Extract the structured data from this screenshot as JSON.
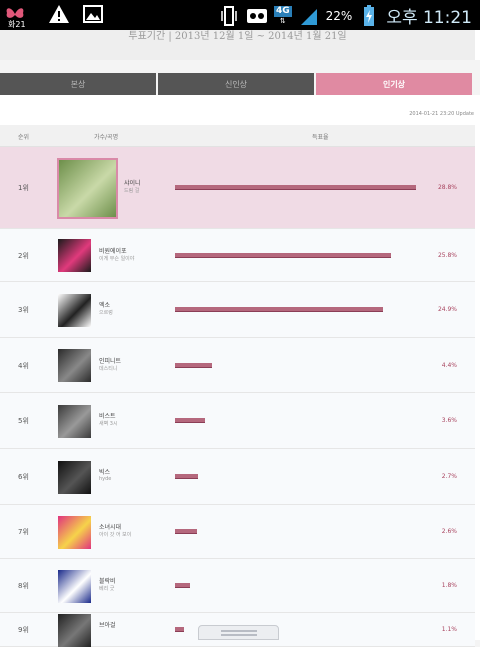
{
  "status_bar": {
    "left_label": "화21",
    "network": "4G",
    "battery": "22%",
    "clock": "오후 11:21"
  },
  "header": {
    "period": "투표기간 | 2013년 12월 1일 ~ 2014년 1월 21일"
  },
  "tabs": [
    {
      "label": "본상",
      "active": false
    },
    {
      "label": "신인상",
      "active": false
    },
    {
      "label": "인기상",
      "active": true
    }
  ],
  "updated": "2014-01-21 23:20 Update",
  "columns": {
    "rank": "순위",
    "artist": "가수/곡명",
    "share": "득표율"
  },
  "accent": "#e08aa2",
  "bar_color": "#b5687d",
  "rows": [
    {
      "rank": "1위",
      "name": "샤이니",
      "sub": "드림 걸",
      "percent": "28.8%",
      "value": 28.8
    },
    {
      "rank": "2위",
      "name": "비원에이포",
      "sub": "이게 무슨 일이야",
      "percent": "25.8%",
      "value": 25.8
    },
    {
      "rank": "3위",
      "name": "엑소",
      "sub": "으르렁",
      "percent": "24.9%",
      "value": 24.9
    },
    {
      "rank": "4위",
      "name": "인피니트",
      "sub": "데스티니",
      "percent": "4.4%",
      "value": 4.4
    },
    {
      "rank": "5위",
      "name": "비스트",
      "sub": "새벽 3시",
      "percent": "3.6%",
      "value": 3.6
    },
    {
      "rank": "6위",
      "name": "빅스",
      "sub": "hyde",
      "percent": "2.7%",
      "value": 2.7
    },
    {
      "rank": "7위",
      "name": "소녀시대",
      "sub": "아이 갓 어 보이",
      "percent": "2.6%",
      "value": 2.6
    },
    {
      "rank": "8위",
      "name": "블락비",
      "sub": "베리 굿",
      "percent": "1.8%",
      "value": 1.8
    },
    {
      "rank": "9위",
      "name": "브아걸",
      "sub": "",
      "percent": "1.1%",
      "value": 1.1
    }
  ]
}
